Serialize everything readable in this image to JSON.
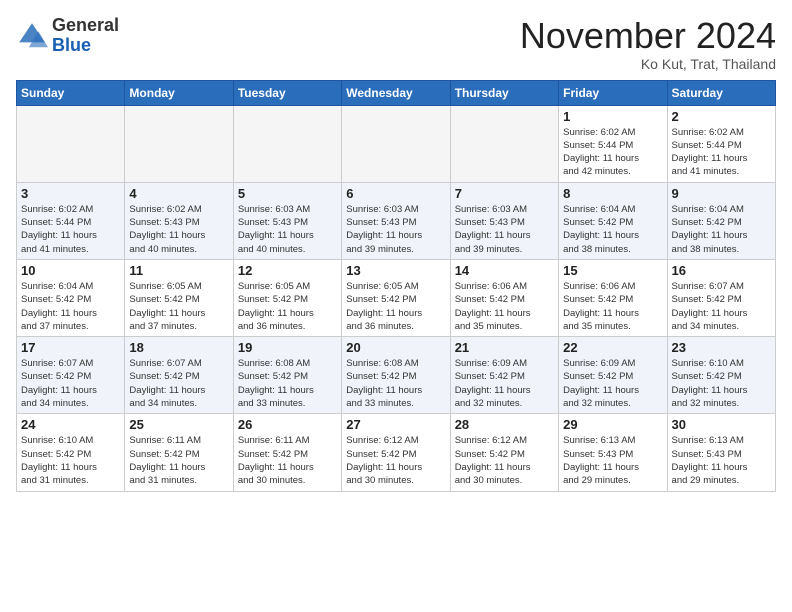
{
  "header": {
    "logo_general": "General",
    "logo_blue": "Blue",
    "month": "November 2024",
    "location": "Ko Kut, Trat, Thailand"
  },
  "days_of_week": [
    "Sunday",
    "Monday",
    "Tuesday",
    "Wednesday",
    "Thursday",
    "Friday",
    "Saturday"
  ],
  "weeks": [
    [
      {
        "day": "",
        "info": ""
      },
      {
        "day": "",
        "info": ""
      },
      {
        "day": "",
        "info": ""
      },
      {
        "day": "",
        "info": ""
      },
      {
        "day": "",
        "info": ""
      },
      {
        "day": "1",
        "info": "Sunrise: 6:02 AM\nSunset: 5:44 PM\nDaylight: 11 hours\nand 42 minutes."
      },
      {
        "day": "2",
        "info": "Sunrise: 6:02 AM\nSunset: 5:44 PM\nDaylight: 11 hours\nand 41 minutes."
      }
    ],
    [
      {
        "day": "3",
        "info": "Sunrise: 6:02 AM\nSunset: 5:44 PM\nDaylight: 11 hours\nand 41 minutes."
      },
      {
        "day": "4",
        "info": "Sunrise: 6:02 AM\nSunset: 5:43 PM\nDaylight: 11 hours\nand 40 minutes."
      },
      {
        "day": "5",
        "info": "Sunrise: 6:03 AM\nSunset: 5:43 PM\nDaylight: 11 hours\nand 40 minutes."
      },
      {
        "day": "6",
        "info": "Sunrise: 6:03 AM\nSunset: 5:43 PM\nDaylight: 11 hours\nand 39 minutes."
      },
      {
        "day": "7",
        "info": "Sunrise: 6:03 AM\nSunset: 5:43 PM\nDaylight: 11 hours\nand 39 minutes."
      },
      {
        "day": "8",
        "info": "Sunrise: 6:04 AM\nSunset: 5:42 PM\nDaylight: 11 hours\nand 38 minutes."
      },
      {
        "day": "9",
        "info": "Sunrise: 6:04 AM\nSunset: 5:42 PM\nDaylight: 11 hours\nand 38 minutes."
      }
    ],
    [
      {
        "day": "10",
        "info": "Sunrise: 6:04 AM\nSunset: 5:42 PM\nDaylight: 11 hours\nand 37 minutes."
      },
      {
        "day": "11",
        "info": "Sunrise: 6:05 AM\nSunset: 5:42 PM\nDaylight: 11 hours\nand 37 minutes."
      },
      {
        "day": "12",
        "info": "Sunrise: 6:05 AM\nSunset: 5:42 PM\nDaylight: 11 hours\nand 36 minutes."
      },
      {
        "day": "13",
        "info": "Sunrise: 6:05 AM\nSunset: 5:42 PM\nDaylight: 11 hours\nand 36 minutes."
      },
      {
        "day": "14",
        "info": "Sunrise: 6:06 AM\nSunset: 5:42 PM\nDaylight: 11 hours\nand 35 minutes."
      },
      {
        "day": "15",
        "info": "Sunrise: 6:06 AM\nSunset: 5:42 PM\nDaylight: 11 hours\nand 35 minutes."
      },
      {
        "day": "16",
        "info": "Sunrise: 6:07 AM\nSunset: 5:42 PM\nDaylight: 11 hours\nand 34 minutes."
      }
    ],
    [
      {
        "day": "17",
        "info": "Sunrise: 6:07 AM\nSunset: 5:42 PM\nDaylight: 11 hours\nand 34 minutes."
      },
      {
        "day": "18",
        "info": "Sunrise: 6:07 AM\nSunset: 5:42 PM\nDaylight: 11 hours\nand 34 minutes."
      },
      {
        "day": "19",
        "info": "Sunrise: 6:08 AM\nSunset: 5:42 PM\nDaylight: 11 hours\nand 33 minutes."
      },
      {
        "day": "20",
        "info": "Sunrise: 6:08 AM\nSunset: 5:42 PM\nDaylight: 11 hours\nand 33 minutes."
      },
      {
        "day": "21",
        "info": "Sunrise: 6:09 AM\nSunset: 5:42 PM\nDaylight: 11 hours\nand 32 minutes."
      },
      {
        "day": "22",
        "info": "Sunrise: 6:09 AM\nSunset: 5:42 PM\nDaylight: 11 hours\nand 32 minutes."
      },
      {
        "day": "23",
        "info": "Sunrise: 6:10 AM\nSunset: 5:42 PM\nDaylight: 11 hours\nand 32 minutes."
      }
    ],
    [
      {
        "day": "24",
        "info": "Sunrise: 6:10 AM\nSunset: 5:42 PM\nDaylight: 11 hours\nand 31 minutes."
      },
      {
        "day": "25",
        "info": "Sunrise: 6:11 AM\nSunset: 5:42 PM\nDaylight: 11 hours\nand 31 minutes."
      },
      {
        "day": "26",
        "info": "Sunrise: 6:11 AM\nSunset: 5:42 PM\nDaylight: 11 hours\nand 30 minutes."
      },
      {
        "day": "27",
        "info": "Sunrise: 6:12 AM\nSunset: 5:42 PM\nDaylight: 11 hours\nand 30 minutes."
      },
      {
        "day": "28",
        "info": "Sunrise: 6:12 AM\nSunset: 5:42 PM\nDaylight: 11 hours\nand 30 minutes."
      },
      {
        "day": "29",
        "info": "Sunrise: 6:13 AM\nSunset: 5:43 PM\nDaylight: 11 hours\nand 29 minutes."
      },
      {
        "day": "30",
        "info": "Sunrise: 6:13 AM\nSunset: 5:43 PM\nDaylight: 11 hours\nand 29 minutes."
      }
    ]
  ]
}
